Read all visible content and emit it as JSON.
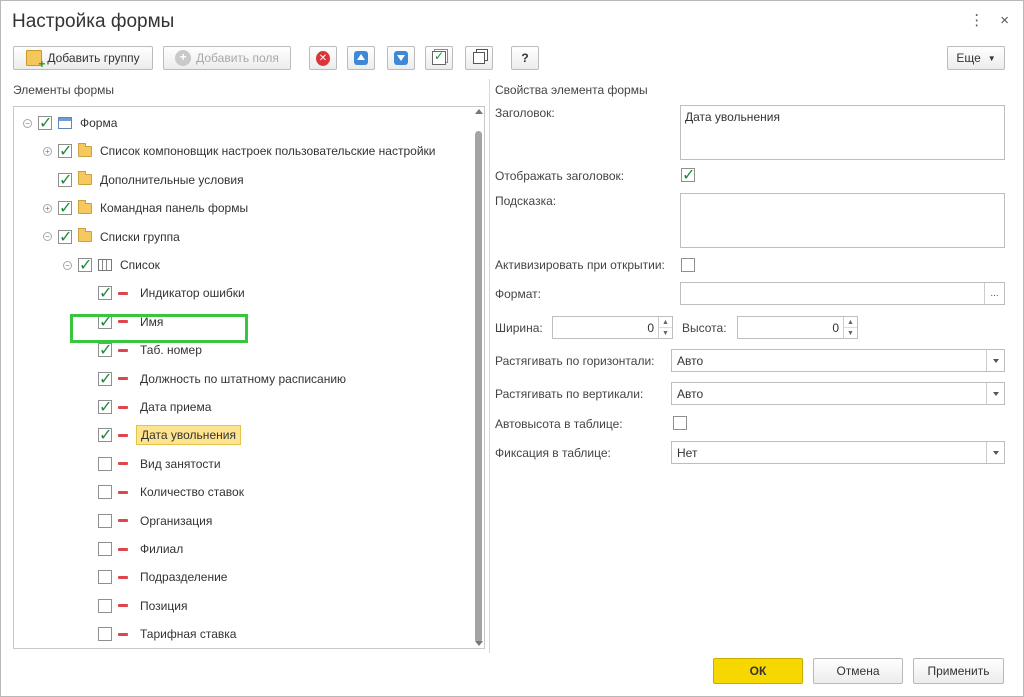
{
  "window": {
    "title": "Настройка формы",
    "menu_icon": "⋮",
    "close_icon": "×"
  },
  "toolbar": {
    "add_group": "Добавить группу",
    "add_fields": "Добавить поля",
    "help": "?",
    "more": "Еще",
    "icons": [
      "add-group-icon",
      "add-fields-icon",
      "delete-icon",
      "move-up-icon",
      "move-down-icon",
      "check-all-icon",
      "uncheck-all-icon"
    ]
  },
  "left": {
    "label": "Элементы формы",
    "tree": [
      {
        "text": "Форма",
        "checked": true,
        "icon": "form",
        "expander": "⊖",
        "level": 0
      },
      {
        "text": "Список компоновщик настроек пользовательские настройки",
        "checked": true,
        "icon": "folder",
        "expander": "⊕",
        "level": 1
      },
      {
        "text": "Дополнительные условия",
        "checked": true,
        "icon": "folder",
        "expander": "",
        "level": 1
      },
      {
        "text": "Командная панель формы",
        "checked": true,
        "icon": "folder",
        "expander": "⊕",
        "level": 1
      },
      {
        "text": "Списки группа",
        "checked": true,
        "icon": "folder",
        "expander": "⊖",
        "level": 1
      },
      {
        "text": "Список",
        "checked": true,
        "icon": "table",
        "expander": "⊖",
        "level": 2
      },
      {
        "text": "Индикатор ошибки",
        "checked": true,
        "icon": "field",
        "expander": "",
        "level": 3
      },
      {
        "text": "Имя",
        "checked": true,
        "icon": "field",
        "expander": "",
        "level": 3
      },
      {
        "text": "Таб. номер",
        "checked": true,
        "icon": "field",
        "expander": "",
        "level": 3
      },
      {
        "text": "Должность по штатному расписанию",
        "checked": true,
        "icon": "field",
        "expander": "",
        "level": 3
      },
      {
        "text": "Дата приема",
        "checked": true,
        "icon": "field",
        "expander": "",
        "level": 3
      },
      {
        "text": "Дата увольнения",
        "checked": true,
        "icon": "field",
        "expander": "",
        "level": 3,
        "selected": true
      },
      {
        "text": "Вид занятости",
        "checked": false,
        "icon": "field",
        "expander": "",
        "level": 3
      },
      {
        "text": "Количество ставок",
        "checked": false,
        "icon": "field",
        "expander": "",
        "level": 3
      },
      {
        "text": "Организация",
        "checked": false,
        "icon": "field",
        "expander": "",
        "level": 3
      },
      {
        "text": "Филиал",
        "checked": false,
        "icon": "field",
        "expander": "",
        "level": 3
      },
      {
        "text": "Подразделение",
        "checked": false,
        "icon": "field",
        "expander": "",
        "level": 3
      },
      {
        "text": "Позиция",
        "checked": false,
        "icon": "field",
        "expander": "",
        "level": 3
      },
      {
        "text": "Тарифная ставка",
        "checked": false,
        "icon": "field",
        "expander": "",
        "level": 3
      }
    ]
  },
  "right": {
    "label": "Свойства элемента формы",
    "caption_label": "Заголовок:",
    "caption_value": "Дата увольнения",
    "show_caption_label": "Отображать заголовок:",
    "show_caption_checked": true,
    "hint_label": "Подсказка:",
    "hint_value": "",
    "activate_label": "Активизировать при открытии:",
    "activate_checked": false,
    "format_label": "Формат:",
    "format_value": "",
    "format_button": "...",
    "width_label": "Ширина:",
    "width_value": "0",
    "height_label": "Высота:",
    "height_value": "0",
    "hstretch_label": "Растягивать по горизонтали:",
    "hstretch_value": "Авто",
    "vstretch_label": "Растягивать по вертикали:",
    "vstretch_value": "Авто",
    "autoheight_label": "Автовысота в таблице:",
    "autoheight_checked": false,
    "fix_label": "Фиксация в таблице:",
    "fix_value": "Нет"
  },
  "footer": {
    "ok": "ОК",
    "cancel": "Отмена",
    "apply": "Применить"
  },
  "colors": {
    "ok_button": "#f7d700",
    "selection_outline": "#39c63f",
    "selected_item": "#ffe48f",
    "check": "#1e8a3c"
  }
}
